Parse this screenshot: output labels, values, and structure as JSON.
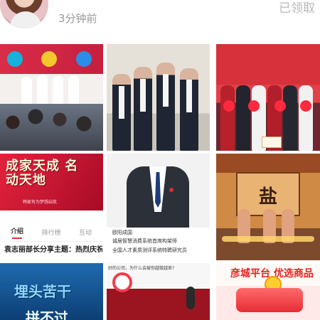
{
  "header": {
    "time": "3分钟前",
    "claimed_status": "已领取"
  },
  "tiles": {
    "t4": {
      "heading": "成家天成 名动天地",
      "poster_sub": "韩家有为梦想启航",
      "tabs": [
        "介绍",
        "排行榜",
        "互动"
      ],
      "caption": "袁志丽部长分享主题：热烈庆祝成家天成"
    },
    "t5": {
      "lines": [
        "欧阳成国",
        "诚居智慧消费系统首席构架师",
        "全国人才素质测评系统特聘研究员"
      ]
    },
    "t6": {
      "sign": "盐"
    },
    "t7": {
      "line1": "埋头苦干",
      "line2": "拼不过"
    },
    "t8": {
      "slide_title": "好的公司，为什么会被你越做越差?"
    },
    "t9": {
      "title": "彦城平台 优选商品"
    }
  },
  "colors": {
    "accent_red": "#e82f2f",
    "muted_text": "#9a9a9a"
  }
}
